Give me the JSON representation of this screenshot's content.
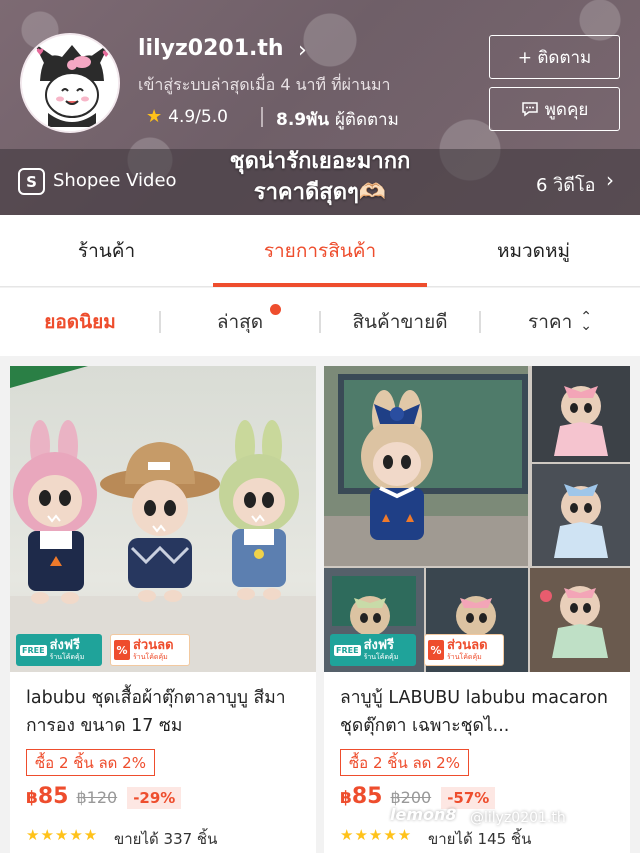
{
  "shop": {
    "name": "lilyz0201.th",
    "status": "เข้าสู่ระบบล่าสุดเมื่อ 4 นาที ที่ผ่านมา",
    "rating": "4.9/5.0",
    "followers_count": "8.9พัน",
    "followers_label": "ผู้ติดตาม",
    "follow_button": "+ ติดตาม",
    "chat_button": "พูดคุย"
  },
  "video": {
    "brand": "Shopee Video",
    "caption_line1": "ชุดน่ารักเยอะมากก",
    "caption_line2": "ราคาดีสุดๆ🫶🏻",
    "count": "6 วิดีโอ"
  },
  "tabs": [
    {
      "label": "ร้านค้า"
    },
    {
      "label": "รายการสินค้า"
    },
    {
      "label": "หมวดหมู่"
    }
  ],
  "sorts": [
    {
      "label": "ยอดนิยม"
    },
    {
      "label": "ล่าสุด"
    },
    {
      "label": "สินค้าขายดี"
    },
    {
      "label": "ราคา"
    }
  ],
  "badges": {
    "free_icon": "FREE",
    "free_title": "ส่งฟรี",
    "free_sub": "ร้านโค้ดคุ้ม",
    "disc_icon": "%",
    "disc_title": "ส่วนลด",
    "disc_sub": "ร้านโค้ดคุ้ม"
  },
  "products": [
    {
      "title": "labubu ชุดเสื้อผ้าตุ๊กตาลาบูบู สีมาการอง ขนาด 17 ซม",
      "promo": "ซื้อ 2 ชิ้น ลด 2%",
      "currency": "฿",
      "price": "85",
      "old_price": "฿120",
      "discount": "-29%",
      "stars": "★★★★★",
      "sold": "ขายได้ 337 ชิ้น"
    },
    {
      "title": "ลาบูบู้ LABUBU labubu macaron ชุดตุ๊กตา เฉพาะชุดไ...",
      "promo": "ซื้อ 2 ชิ้น ลด 2%",
      "currency": "฿",
      "price": "85",
      "old_price": "฿200",
      "discount": "-57%",
      "stars": "★★★★★",
      "sold": "ขายได้ 145 ชิ้น"
    }
  ],
  "watermark": {
    "logo": "lemon8",
    "handle": "@lilyz0201.th"
  },
  "colors": {
    "accent": "#ee4d2d",
    "star": "#ffc21a",
    "free_badge": "#1fa39a"
  }
}
